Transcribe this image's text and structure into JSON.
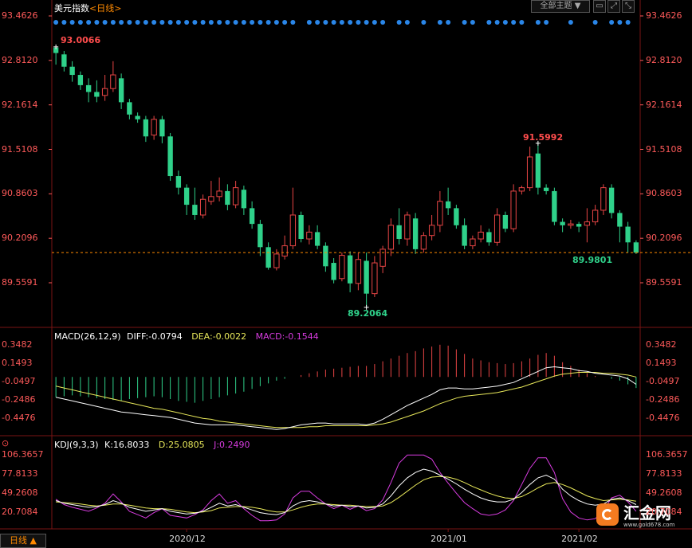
{
  "header": {
    "title": "美元指数",
    "period": "<日线>",
    "theme_button": "全部主题",
    "theme_arrow": "▼"
  },
  "price_axis": {
    "ticks": [
      "93.4626",
      "92.8120",
      "92.1614",
      "91.5108",
      "90.8603",
      "90.2096",
      "89.5591"
    ]
  },
  "annotations": {
    "high_label": "93.0066",
    "peak_label": "91.5992",
    "low_label": "89.2064",
    "last_label": "89.9801"
  },
  "macd": {
    "title": "MACD(26,12,9)",
    "diff_label": "DIFF:-0.0794",
    "dea_label": "DEA:-0.0022",
    "macd_label": "MACD:-0.1544",
    "ticks": [
      "0.3482",
      "0.1493",
      "-0.0497",
      "-0.2486",
      "-0.4476"
    ]
  },
  "kdj": {
    "title": "KDJ(9,3,3)",
    "k_label": "K:16.8033",
    "d_label": "D:25.0805",
    "j_label": "J:0.2490",
    "ticks": [
      "106.3657",
      "77.8133",
      "49.2608",
      "20.7084"
    ]
  },
  "footer": {
    "period_button": "日线 ▲",
    "dates": [
      "2020/12",
      "2021/01",
      "2021/02"
    ]
  },
  "logo": {
    "name": "汇金网",
    "url": "www.gold678.com"
  },
  "colors": {
    "up": "#e84545",
    "down": "#2fd18a",
    "diff": "#ffffff",
    "dea": "#e8e85a",
    "j": "#d83ce0",
    "accent": "#ff8a00"
  },
  "chart_data": {
    "type": "candlestick",
    "candles": [
      [
        93.0,
        92.92,
        93.01,
        92.75
      ],
      [
        92.9,
        92.72,
        92.95,
        92.65
      ],
      [
        92.72,
        92.6,
        92.8,
        92.5
      ],
      [
        92.6,
        92.45,
        92.65,
        92.38
      ],
      [
        92.45,
        92.35,
        92.55,
        92.2
      ],
      [
        92.35,
        92.28,
        92.52,
        92.2
      ],
      [
        92.3,
        92.4,
        92.6,
        92.22
      ],
      [
        92.4,
        92.6,
        92.8,
        92.35
      ],
      [
        92.55,
        92.2,
        92.62,
        92.1
      ],
      [
        92.2,
        92.02,
        92.25,
        91.95
      ],
      [
        92.0,
        91.95,
        92.05,
        91.9
      ],
      [
        91.95,
        91.7,
        92.0,
        91.62
      ],
      [
        91.72,
        91.95,
        92.0,
        91.65
      ],
      [
        91.95,
        91.7,
        92.0,
        91.6
      ],
      [
        91.7,
        91.12,
        91.75,
        91.05
      ],
      [
        91.12,
        90.95,
        91.2,
        90.85
      ],
      [
        90.95,
        90.7,
        91.0,
        90.55
      ],
      [
        90.7,
        90.55,
        90.95,
        90.48
      ],
      [
        90.55,
        90.78,
        90.85,
        90.5
      ],
      [
        90.75,
        90.82,
        91.05,
        90.7
      ],
      [
        90.82,
        90.9,
        91.1,
        90.75
      ],
      [
        90.9,
        90.7,
        91.0,
        90.62
      ],
      [
        90.7,
        90.95,
        91.05,
        90.65
      ],
      [
        90.92,
        90.65,
        90.98,
        90.55
      ],
      [
        90.65,
        90.42,
        90.75,
        90.35
      ],
      [
        90.42,
        90.08,
        90.48,
        89.95
      ],
      [
        90.08,
        89.78,
        90.15,
        89.75
      ],
      [
        89.78,
        89.98,
        90.05,
        89.74
      ],
      [
        89.95,
        90.1,
        90.25,
        89.9
      ],
      [
        90.1,
        90.55,
        90.95,
        90.05
      ],
      [
        90.55,
        90.2,
        90.6,
        90.15
      ],
      [
        90.2,
        90.3,
        90.4,
        90.12
      ],
      [
        90.3,
        90.1,
        90.4,
        90.05
      ],
      [
        90.1,
        89.8,
        90.15,
        89.72
      ],
      [
        89.85,
        89.6,
        89.92,
        89.55
      ],
      [
        89.62,
        89.96,
        90.0,
        89.58
      ],
      [
        89.96,
        89.55,
        90.02,
        89.42
      ],
      [
        89.55,
        89.9,
        90.0,
        89.45
      ],
      [
        89.88,
        89.4,
        90.0,
        89.2
      ],
      [
        89.4,
        89.85,
        89.95,
        89.35
      ],
      [
        89.8,
        90.05,
        90.1,
        89.7
      ],
      [
        90.05,
        90.4,
        90.5,
        89.95
      ],
      [
        90.4,
        90.2,
        90.65,
        90.12
      ],
      [
        90.2,
        90.55,
        90.6,
        90.1
      ],
      [
        90.5,
        90.05,
        90.58,
        89.98
      ],
      [
        90.05,
        90.25,
        90.3,
        90.0
      ],
      [
        90.25,
        90.4,
        90.55,
        90.18
      ],
      [
        90.4,
        90.75,
        90.9,
        90.3
      ],
      [
        90.75,
        90.65,
        90.95,
        90.55
      ],
      [
        90.65,
        90.4,
        90.7,
        90.35
      ],
      [
        90.4,
        90.1,
        90.5,
        90.05
      ],
      [
        90.1,
        90.2,
        90.25,
        90.05
      ],
      [
        90.2,
        90.3,
        90.4,
        90.15
      ],
      [
        90.3,
        90.15,
        90.35,
        90.1
      ],
      [
        90.15,
        90.55,
        90.65,
        90.1
      ],
      [
        90.55,
        90.35,
        90.6,
        90.3
      ],
      [
        90.35,
        90.9,
        91.0,
        90.3
      ],
      [
        90.9,
        90.95,
        90.98,
        90.85
      ],
      [
        90.95,
        91.4,
        91.55,
        90.9
      ],
      [
        91.45,
        90.95,
        91.6,
        90.85
      ],
      [
        90.95,
        90.9,
        91.0,
        90.85
      ],
      [
        90.9,
        90.45,
        90.95,
        90.4
      ],
      [
        90.45,
        90.4,
        90.5,
        90.3
      ],
      [
        90.4,
        90.42,
        90.48,
        90.35
      ],
      [
        90.42,
        90.38,
        90.45,
        90.3
      ],
      [
        90.4,
        90.45,
        90.65,
        90.15
      ],
      [
        90.45,
        90.62,
        90.7,
        90.4
      ],
      [
        90.62,
        90.95,
        91.0,
        90.55
      ],
      [
        90.95,
        90.58,
        91.0,
        90.5
      ],
      [
        90.58,
        90.38,
        90.62,
        90.15
      ],
      [
        90.38,
        90.15,
        90.45,
        90.0
      ],
      [
        90.15,
        90.0,
        90.18,
        89.98
      ]
    ],
    "macd_hist": [
      -0.22,
      -0.21,
      -0.2,
      -0.21,
      -0.22,
      -0.23,
      -0.24,
      -0.25,
      -0.26,
      -0.24,
      -0.23,
      -0.22,
      -0.21,
      -0.22,
      -0.24,
      -0.26,
      -0.27,
      -0.28,
      -0.26,
      -0.24,
      -0.22,
      -0.2,
      -0.18,
      -0.16,
      -0.13,
      -0.1,
      -0.07,
      -0.04,
      -0.02,
      0.0,
      0.02,
      0.04,
      0.06,
      0.08,
      0.09,
      0.1,
      0.11,
      0.12,
      0.12,
      0.14,
      0.17,
      0.2,
      0.23,
      0.26,
      0.28,
      0.31,
      0.33,
      0.35,
      0.34,
      0.3,
      0.25,
      0.2,
      0.18,
      0.16,
      0.15,
      0.14,
      0.15,
      0.17,
      0.2,
      0.24,
      0.26,
      0.23,
      0.16,
      0.12,
      0.08,
      0.04,
      0.01,
      0.0,
      -0.02,
      -0.04,
      -0.08,
      -0.12
    ],
    "macd_diff": [
      -0.22,
      -0.24,
      -0.26,
      -0.28,
      -0.3,
      -0.32,
      -0.34,
      -0.36,
      -0.38,
      -0.39,
      -0.4,
      -0.41,
      -0.42,
      -0.43,
      -0.44,
      -0.46,
      -0.48,
      -0.5,
      -0.51,
      -0.52,
      -0.52,
      -0.52,
      -0.52,
      -0.53,
      -0.54,
      -0.55,
      -0.56,
      -0.57,
      -0.56,
      -0.54,
      -0.52,
      -0.51,
      -0.5,
      -0.5,
      -0.51,
      -0.51,
      -0.51,
      -0.51,
      -0.52,
      -0.5,
      -0.46,
      -0.41,
      -0.36,
      -0.31,
      -0.27,
      -0.23,
      -0.19,
      -0.14,
      -0.12,
      -0.12,
      -0.13,
      -0.13,
      -0.12,
      -0.11,
      -0.1,
      -0.08,
      -0.06,
      -0.02,
      0.02,
      0.06,
      0.1,
      0.11,
      0.1,
      0.09,
      0.07,
      0.06,
      0.04,
      0.03,
      0.02,
      0.01,
      -0.02,
      -0.08
    ],
    "macd_dea": [
      -0.1,
      -0.12,
      -0.14,
      -0.16,
      -0.18,
      -0.2,
      -0.22,
      -0.24,
      -0.26,
      -0.28,
      -0.3,
      -0.32,
      -0.34,
      -0.35,
      -0.37,
      -0.39,
      -0.41,
      -0.43,
      -0.45,
      -0.46,
      -0.48,
      -0.49,
      -0.5,
      -0.51,
      -0.52,
      -0.53,
      -0.54,
      -0.55,
      -0.55,
      -0.55,
      -0.55,
      -0.54,
      -0.54,
      -0.53,
      -0.53,
      -0.53,
      -0.53,
      -0.53,
      -0.53,
      -0.52,
      -0.51,
      -0.49,
      -0.46,
      -0.43,
      -0.4,
      -0.37,
      -0.33,
      -0.29,
      -0.26,
      -0.23,
      -0.21,
      -0.2,
      -0.19,
      -0.18,
      -0.17,
      -0.15,
      -0.13,
      -0.11,
      -0.08,
      -0.05,
      -0.02,
      0.01,
      0.03,
      0.04,
      0.05,
      0.05,
      0.05,
      0.04,
      0.04,
      0.03,
      0.02,
      0.0
    ],
    "kdj_k": [
      38,
      34,
      32,
      30,
      28,
      29,
      32,
      38,
      34,
      28,
      25,
      22,
      24,
      26,
      22,
      20,
      18,
      19,
      22,
      28,
      34,
      30,
      32,
      28,
      24,
      20,
      18,
      17,
      20,
      30,
      36,
      38,
      36,
      33,
      30,
      31,
      29,
      30,
      27,
      28,
      33,
      45,
      60,
      72,
      80,
      85,
      82,
      76,
      70,
      63,
      55,
      48,
      42,
      38,
      36,
      36,
      40,
      50,
      62,
      72,
      76,
      70,
      55,
      45,
      38,
      33,
      31,
      33,
      40,
      42,
      38,
      32
    ],
    "kdj_d": [
      36,
      35,
      34,
      33,
      31,
      30,
      31,
      33,
      33,
      31,
      29,
      27,
      26,
      26,
      25,
      23,
      21,
      20,
      21,
      23,
      27,
      28,
      29,
      29,
      28,
      26,
      23,
      21,
      21,
      24,
      28,
      31,
      33,
      33,
      32,
      31,
      31,
      30,
      29,
      29,
      30,
      35,
      43,
      52,
      61,
      69,
      73,
      74,
      73,
      70,
      65,
      59,
      54,
      49,
      45,
      42,
      41,
      44,
      50,
      57,
      63,
      65,
      62,
      57,
      51,
      45,
      41,
      38,
      39,
      40,
      39,
      37
    ],
    "kdj_j": [
      40,
      32,
      28,
      25,
      22,
      27,
      34,
      48,
      36,
      22,
      17,
      12,
      20,
      26,
      16,
      14,
      12,
      17,
      24,
      38,
      48,
      34,
      38,
      26,
      16,
      8,
      8,
      9,
      18,
      42,
      52,
      52,
      42,
      33,
      26,
      31,
      25,
      30,
      23,
      26,
      39,
      65,
      94,
      106,
      106,
      106,
      100,
      80,
      64,
      49,
      35,
      26,
      18,
      16,
      18,
      24,
      38,
      62,
      86,
      102,
      102,
      80,
      41,
      21,
      12,
      9,
      11,
      23,
      42,
      46,
      36,
      22
    ]
  }
}
